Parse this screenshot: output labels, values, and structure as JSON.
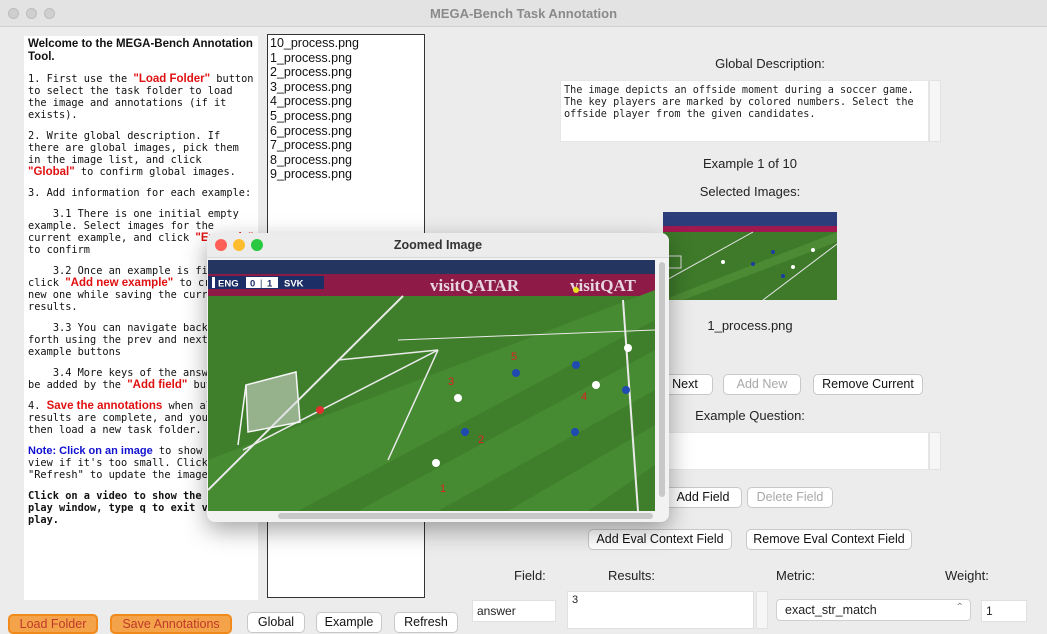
{
  "window": {
    "title": "MEGA-Bench Task Annotation"
  },
  "instructions": {
    "heading": "Welcome to the MEGA-Bench Annotation Tool.",
    "step1_a": "1. First use the ",
    "step1_b": "\"Load Folder\"",
    "step1_c": " button to select the task folder to load the image and annotations (if it exists).",
    "step2_a": "2. Write global description. If there are global images, pick them in the image list, and click ",
    "step2_b": "\"Global\"",
    "step2_c": " to confirm global images.",
    "step3": "3. Add information for each example:",
    "step31_a": "    3.1 There is one initial empty example. Select images for the current example, and click ",
    "step31_b": "\"Example\"",
    "step31_c": " to confirm",
    "step32_a": "    3.2 Once an example is finished, click ",
    "step32_b": "\"Add new example\"",
    "step32_c": " to create a new one while saving the current results.",
    "step33": "    3.3 You can navigate back and forth using the prev and next example buttons",
    "step34_a": "    3.4 More keys of the answer can be added by the ",
    "step34_b": "\"Add field\"",
    "step34_c": " button",
    "step4_a": "4. ",
    "step4_b": "Save the annotations",
    "step4_c": " when all results are complete, and you can then load a new task folder.",
    "note_a": "Note: Click on an image",
    "note_b": " to show zoom-in view if it's too small. Click \"Refresh\" to update the image list.",
    "video_note": "Click on a video to show the video-play window, type q to exit video play."
  },
  "file_list": [
    "10_process.png",
    "1_process.png",
    "2_process.png",
    "3_process.png",
    "4_process.png",
    "5_process.png",
    "6_process.png",
    "7_process.png",
    "8_process.png",
    "9_process.png"
  ],
  "global_description": {
    "label": "Global Description:",
    "text": "The image depicts an offside moment during a soccer game.\nThe key players are marked by colored numbers. Select the\noffside player from the given candidates."
  },
  "example": {
    "counter": "Example 1 of 10",
    "selected_images_label": "Selected Images:",
    "image_name": "1_process.png",
    "question_label": "Example Question:"
  },
  "buttons": {
    "next": "Next",
    "add_new": "Add New",
    "remove_current": "Remove Current",
    "add_field": "Add Field",
    "delete_field": "Delete Field",
    "add_eval": "Add Eval Context Field",
    "remove_eval": "Remove Eval Context Field",
    "load_folder": "Load Folder",
    "save_annotations": "Save Annotations",
    "global": "Global",
    "example": "Example",
    "refresh": "Refresh"
  },
  "fields": {
    "field_label": "Field:",
    "results_label": "Results:",
    "metric_label": "Metric:",
    "weight_label": "Weight:",
    "field_value": "answer",
    "results_value": "3",
    "metric_value": "exact_str_match",
    "weight_value": "1"
  },
  "zoom_window": {
    "title": "Zoomed Image",
    "score_home": "ENG",
    "score_home_goals": "0",
    "score_away_goals": "1",
    "score_away": "SVK",
    "ad_text": "visitQATAR",
    "ad_text2": "visitQAT",
    "markers": [
      "1",
      "2",
      "3",
      "4",
      "5"
    ]
  },
  "colors": {
    "accent_red": "#e01010",
    "accent_blue": "#1010d0",
    "button_orange": "#f4a34a"
  }
}
